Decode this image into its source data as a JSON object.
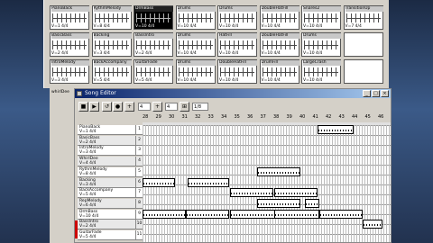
{
  "pattern_browser": {
    "patterns": [
      {
        "name": "PianoBack",
        "info": "V=1 4/4",
        "selected": false
      },
      {
        "name": "RythmMelody",
        "info": "V=8 4/4",
        "selected": false
      },
      {
        "name": "DrmBass",
        "info": "V=10 4/4",
        "selected": true
      },
      {
        "name": "Drums",
        "info": "V=10 4/4",
        "selected": false
      },
      {
        "name": "Drums",
        "info": "V=10 4/4",
        "selected": false
      },
      {
        "name": "DoubleHatFill",
        "info": "V=10 4/4",
        "selected": false
      },
      {
        "name": "Snares2",
        "info": "V=10 4/4",
        "selected": false
      },
      {
        "name": "TransitionUp",
        "info": "V=7 4/4",
        "selected": false
      },
      {
        "name": "BasicBass",
        "info": "V=2 4/4",
        "selected": false
      },
      {
        "name": "Backing",
        "info": "V=3 4/4",
        "selected": false
      },
      {
        "name": "BassIntro",
        "info": "V=2 4/4",
        "selected": false
      },
      {
        "name": "Drums",
        "info": "V=10 4/4",
        "selected": false
      },
      {
        "name": "HatFill",
        "info": "V=10 4/4",
        "selected": false
      },
      {
        "name": "DoubleHatFill",
        "info": "V=10 4/4",
        "selected": false
      },
      {
        "name": "Drums",
        "info": "V=10 4/4",
        "selected": false
      },
      {
        "name": "",
        "info": "",
        "selected": false
      },
      {
        "name": "IntroMelody",
        "info": "V=3 4/4",
        "selected": false
      },
      {
        "name": "BackAccompany",
        "info": "V=5 4/4",
        "selected": false
      },
      {
        "name": "GuitarFade",
        "info": "V=5 4/4",
        "selected": false
      },
      {
        "name": "Drums",
        "info": "V=10 4/4",
        "selected": false
      },
      {
        "name": "DoubleHatFill",
        "info": "V=10 4/4",
        "selected": false
      },
      {
        "name": "DrumFill",
        "info": "V=10 4/4",
        "selected": false
      },
      {
        "name": "LargeCrash",
        "info": "V=10 4/4",
        "selected": false
      },
      {
        "name": "",
        "info": "",
        "selected": false
      }
    ]
  },
  "left_strip": {
    "label": "whirlDee"
  },
  "song_editor": {
    "title": "Song Editor",
    "toolbar": {
      "stop_icon": "stop-icon",
      "play_icon": "play-icon",
      "field1": "4",
      "field2": "4",
      "field3": "1/8"
    },
    "ruler": [
      "28",
      "29",
      "30",
      "31",
      "32",
      "33",
      "34",
      "35",
      "36",
      "37",
      "38",
      "39",
      "40",
      "41",
      "42",
      "43",
      "44",
      "45",
      "46"
    ],
    "tracks": [
      {
        "name": "PianoBack",
        "info": "V=1 4/4",
        "num": "1"
      },
      {
        "name": "BasicBass",
        "info": "V=2 4/4",
        "num": "2"
      },
      {
        "name": "IntroMelody",
        "info": "V=3 4/4",
        "num": "3"
      },
      {
        "name": "WhirlDee",
        "info": "V=4 4/4",
        "num": "4"
      },
      {
        "name": "RythmMelody",
        "info": "V=8 4/4",
        "num": "5"
      },
      {
        "name": "Backing",
        "info": "V=3 4/4",
        "num": "6"
      },
      {
        "name": "BackAccompany",
        "info": "V=5 4/4",
        "num": "7"
      },
      {
        "name": "RepMelody",
        "info": "V=6 4/4",
        "num": "8"
      },
      {
        "name": "DrmBass",
        "info": "V=10 4/4",
        "num": "9"
      },
      {
        "name": "BassIntro",
        "info": "V=2 4/4",
        "num": "10"
      },
      {
        "name": "GuitarFade",
        "info": "V=5 4/4",
        "num": "11"
      }
    ]
  }
}
